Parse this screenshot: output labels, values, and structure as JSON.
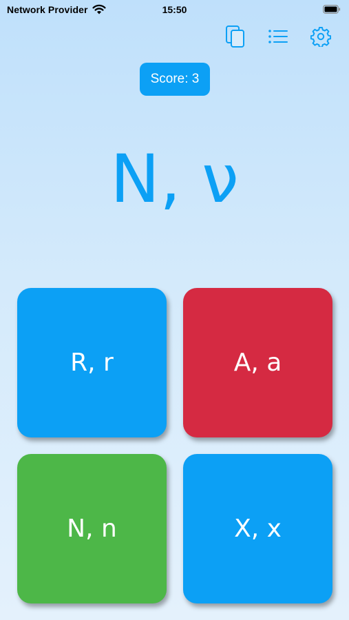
{
  "status_bar": {
    "carrier": "Network Provider",
    "time": "15:50",
    "wifi_icon": "wifi-icon",
    "battery_icon": "battery-icon"
  },
  "toolbar": {
    "icons": [
      "cards-icon",
      "list-icon",
      "gear-icon"
    ]
  },
  "score": {
    "label": "Score: 3"
  },
  "question": {
    "text": "N, ν"
  },
  "answers": [
    {
      "label": "R, r",
      "color": "#0ca0f5"
    },
    {
      "label": "A, a",
      "color": "#d52a42"
    },
    {
      "label": "N, n",
      "color": "#4db748"
    },
    {
      "label": "X, x",
      "color": "#0ca0f5"
    }
  ],
  "colors": {
    "accent": "#0ca0f5",
    "wrong": "#d52a42",
    "correct": "#4db748"
  }
}
